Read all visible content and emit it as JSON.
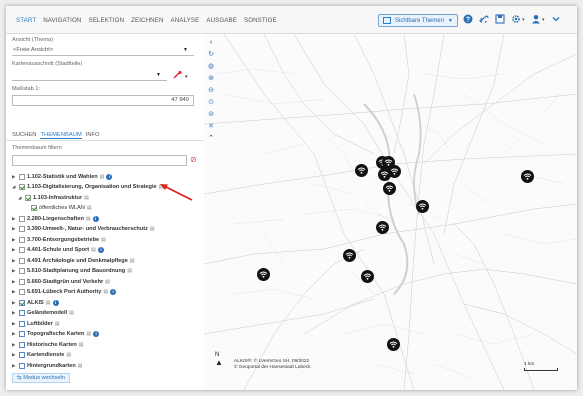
{
  "menu": {
    "items": [
      "START",
      "NAVIGATION",
      "SELEKTION",
      "ZEICHNEN",
      "ANALYSE",
      "AUSGABE",
      "SONSTIGE"
    ],
    "active_index": 0
  },
  "themen_button": {
    "label": "Sichtbare Themen"
  },
  "left_panel": {
    "ansicht_label": "Ansicht (Thema)",
    "ansicht_value": "<Freie Ansicht>",
    "karten_label": "Kartenausschnitt (Stadtteile)",
    "karten_value": "",
    "massstab_label": "Maßstab 1:",
    "massstab_value": "47 940",
    "tabs": [
      "SUCHEN",
      "THEMENBAUM",
      "INFO"
    ],
    "active_tab": 1,
    "filter_label": "Themenbaum filtern",
    "filter_placeholder": "",
    "modus_label": "Modus wechseln"
  },
  "tree": [
    {
      "label": "1.102-Statistik und Wahlen",
      "checked": false,
      "expanded": false,
      "info": true
    },
    {
      "label": "1.103-Digitalisierung, Organisation und Strategie",
      "checked": true,
      "expanded": true,
      "info": false
    },
    {
      "label": "1.103-Infrastruktur",
      "checked": true,
      "expanded": true,
      "info": false
    },
    {
      "label": "öffentliches WLAN",
      "checked": true,
      "expanded": false,
      "info": false
    },
    {
      "label": "2.280-Liegenschaften",
      "checked": false,
      "expanded": false,
      "info": true
    },
    {
      "label": "3.390-Umwelt-, Natur- und Verbraucherschutz",
      "checked": false,
      "expanded": false,
      "info": false
    },
    {
      "label": "3.700-Entsorgungsbetriebe",
      "checked": false,
      "expanded": false,
      "info": false
    },
    {
      "label": "4.401-Schule und Sport",
      "checked": false,
      "expanded": false,
      "info": true
    },
    {
      "label": "4.491 Archäologie und Denkmalpflege",
      "checked": false,
      "expanded": false,
      "info": false
    },
    {
      "label": "5.610-Stadtplanung und Bauordnung",
      "checked": false,
      "expanded": false,
      "info": false
    },
    {
      "label": "5.660-Stadtgrün und Verkehr",
      "checked": false,
      "expanded": false,
      "info": false
    },
    {
      "label": "5.691-Lübeck Port Authority",
      "checked": false,
      "expanded": false,
      "info": true
    },
    {
      "label": "ALKIS",
      "checked": true,
      "expanded": false,
      "info": true
    },
    {
      "label": "Geländemodell",
      "checked": false,
      "expanded": false,
      "info": false
    },
    {
      "label": "Luftbilder",
      "checked": false,
      "expanded": false,
      "info": false
    },
    {
      "label": "Topografische Karten",
      "checked": false,
      "expanded": false,
      "info": true
    },
    {
      "label": "Historische Karten",
      "checked": false,
      "expanded": false,
      "info": false
    },
    {
      "label": "Kartendienste",
      "checked": false,
      "expanded": false,
      "info": false
    },
    {
      "label": "Hintergrundkarten",
      "checked": false,
      "expanded": false,
      "info": false
    }
  ],
  "map": {
    "attribution_line1": "ALKIS®: © LVermGeo SH, 09/2022",
    "attribution_line2": "© Geoportal der Hansestadt Lübeck",
    "scale_label": "1 km",
    "north_label": "N"
  },
  "colors": {
    "accent": "#2a7fc9",
    "arrow": "#d9231f"
  }
}
